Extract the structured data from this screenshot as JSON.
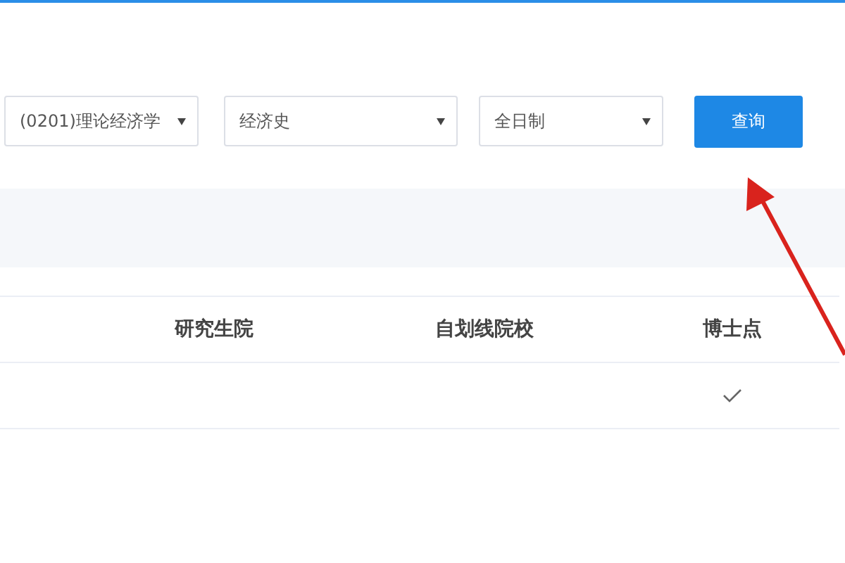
{
  "filters": [
    {
      "kind": "select",
      "value": "(0201)理论经济学"
    },
    {
      "kind": "select",
      "value": "经济史"
    },
    {
      "kind": "select",
      "value": "全日制"
    }
  ],
  "search_button": "查询",
  "table": {
    "columns": [
      "研究生院",
      "自划线院校",
      "博士点"
    ],
    "rows": [
      {
        "doctoral": true
      }
    ]
  },
  "annotation": {
    "kind": "arrow"
  }
}
